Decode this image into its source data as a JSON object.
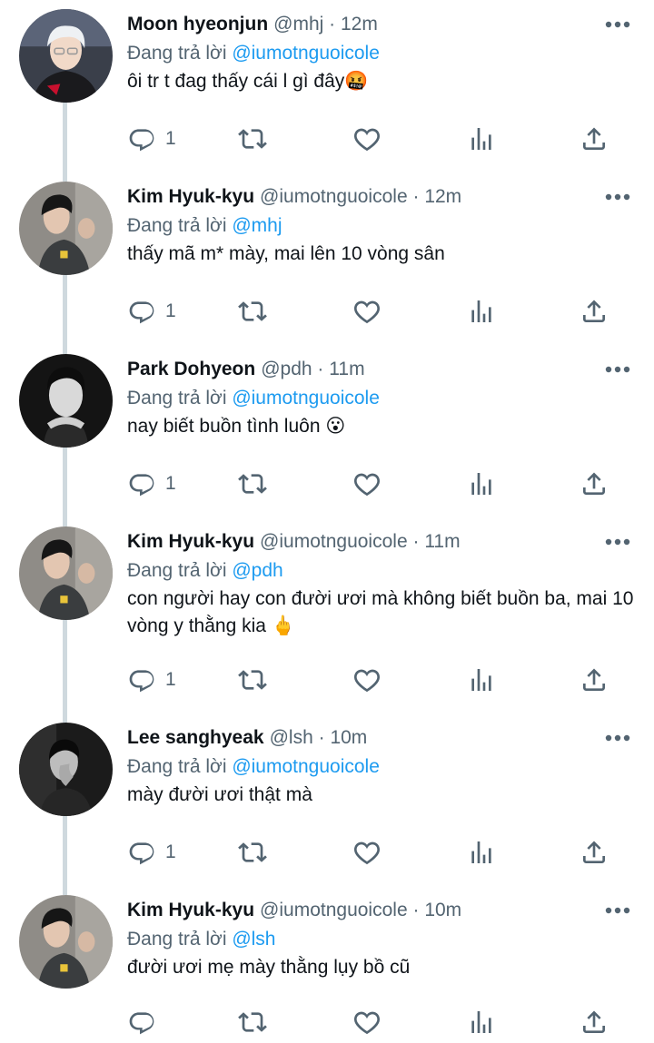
{
  "reply_prefix": "Đang trả lời",
  "separator": "·",
  "tweets": [
    {
      "name": "Moon hyeonjun",
      "handle": "@mhj",
      "time": "12m",
      "reply_to": "@iumotnguoicole",
      "text": "ôi tr t đag thấy cái l gì đây🤬",
      "reply_count": "1",
      "avatar": "mhj"
    },
    {
      "name": "Kim Hyuk-kyu",
      "handle": "@iumotnguoicole",
      "time": "12m",
      "reply_to": "@mhj",
      "text": "thấy mã m* mày, mai lên 10 vòng sân",
      "reply_count": "1",
      "avatar": "khk"
    },
    {
      "name": "Park Dohyeon",
      "handle": "@pdh",
      "time": "11m",
      "reply_to": "@iumotnguoicole",
      "text": "nay biết buồn tình luôn 😮",
      "reply_count": "1",
      "avatar": "pdh"
    },
    {
      "name": "Kim Hyuk-kyu",
      "handle": "@iumotnguoicole",
      "time": "11m",
      "reply_to": "@pdh",
      "text": "con người hay con đười ươi mà không biết buồn ba, mai 10 vòng y thằng kia 🖕",
      "reply_count": "1",
      "avatar": "khk"
    },
    {
      "name": "Lee sanghyeak",
      "handle": "@lsh",
      "time": "10m",
      "reply_to": "@iumotnguoicole",
      "text": "mày đười ươi thật mà",
      "reply_count": "1",
      "avatar": "lsh"
    },
    {
      "name": "Kim Hyuk-kyu",
      "handle": "@iumotnguoicole",
      "time": "10m",
      "reply_to": "@lsh",
      "text": "đười ươi mẹ mày thằng lụy bồ cũ",
      "reply_count": "",
      "avatar": "khk"
    }
  ],
  "icons": {
    "reply": "reply-icon",
    "retweet": "retweet-icon",
    "like": "heart-icon",
    "stats": "stats-icon",
    "share": "share-icon",
    "more": "more-icon"
  },
  "colors": {
    "name": "#0f1419",
    "secondary": "#536471",
    "mention": "#1d9bf0",
    "thread_line": "#cfd9de"
  }
}
